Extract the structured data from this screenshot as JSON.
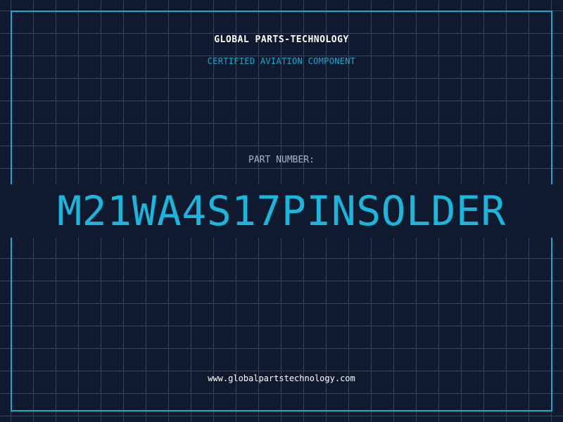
{
  "brand": "GLOBAL PARTS-TECHNOLOGY",
  "subtitle": "CERTIFIED AVIATION COMPONENT",
  "part": {
    "label": "PART NUMBER:",
    "value": "M21WA4S17PINSOLDER"
  },
  "website": "www.globalpartstechnology.com",
  "colors": {
    "background": "#101a2e",
    "grid": "#1f4c6a",
    "accent": "#19a9cf",
    "part_number": "#19b6dd",
    "text": "#ffffff",
    "label": "#a9b4c4"
  }
}
